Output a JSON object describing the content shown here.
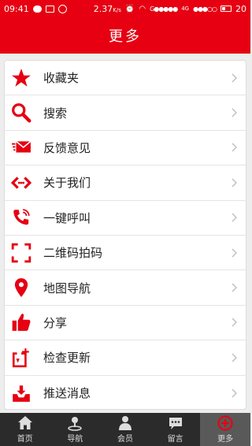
{
  "status": {
    "time": "09:41",
    "data_rate": "2.37",
    "data_unit": "K/s",
    "signal_text": "G●●●●●",
    "network": "4G",
    "signal2": "●●●○○",
    "battery": "20"
  },
  "header": {
    "title": "更多"
  },
  "menu": {
    "items": [
      {
        "label": "收藏夹",
        "icon": "star-icon"
      },
      {
        "label": "搜索",
        "icon": "search-icon"
      },
      {
        "label": "反馈意见",
        "icon": "mail-icon"
      },
      {
        "label": "关于我们",
        "icon": "code-arrows-icon"
      },
      {
        "label": "一键呼叫",
        "icon": "phone-icon"
      },
      {
        "label": "二维码拍码",
        "icon": "scan-frame-icon"
      },
      {
        "label": "地图导航",
        "icon": "map-pin-icon"
      },
      {
        "label": "分享",
        "icon": "thumbs-up-icon"
      },
      {
        "label": "检查更新",
        "icon": "update-icon"
      },
      {
        "label": "推送消息",
        "icon": "inbox-icon"
      }
    ]
  },
  "nav": {
    "items": [
      {
        "label": "首页",
        "icon": "home-icon"
      },
      {
        "label": "导航",
        "icon": "navigation-icon"
      },
      {
        "label": "会员",
        "icon": "member-icon"
      },
      {
        "label": "留言",
        "icon": "message-icon"
      },
      {
        "label": "更多",
        "icon": "plus-circle-icon",
        "active": true
      }
    ]
  },
  "colors": {
    "brand": "#e60012",
    "nav_bg": "#2b2b2b",
    "nav_active": "#595959"
  }
}
